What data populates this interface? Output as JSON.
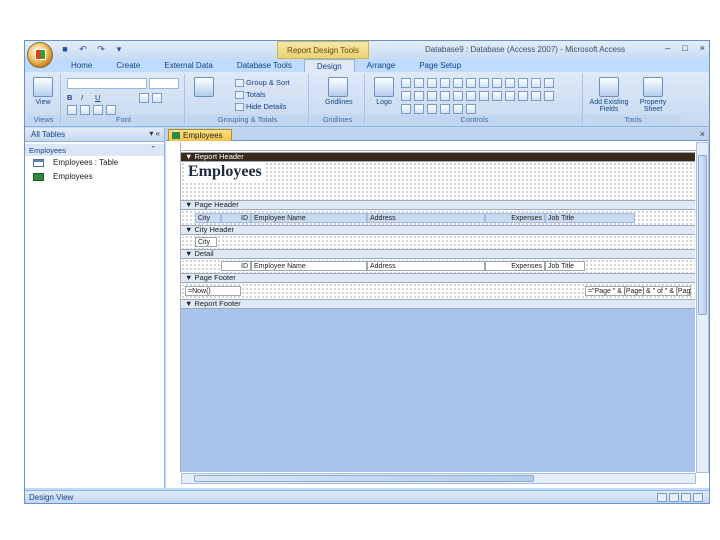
{
  "window": {
    "title": "Database9 : Database (Access 2007) - Microsoft Access",
    "context_tab": "Report Design Tools",
    "controls": [
      "–",
      "□",
      "×"
    ]
  },
  "tabs": [
    {
      "label": "Home"
    },
    {
      "label": "Create"
    },
    {
      "label": "External Data"
    },
    {
      "label": "Database Tools"
    },
    {
      "label": "Design"
    },
    {
      "label": "Arrange"
    },
    {
      "label": "Page Setup"
    }
  ],
  "ribbon": {
    "views": {
      "view_label": "View",
      "group_label": "Views"
    },
    "font": {
      "group_label": "Font",
      "bold": "B",
      "italic": "I",
      "underline": "U"
    },
    "grouping": {
      "group_sort": "Group & Sort",
      "totals": "Totals",
      "hide_details": "Hide Details",
      "group_label": "Grouping & Totals"
    },
    "gridlines": {
      "label": "Gridlines",
      "group_label": "Gridlines"
    },
    "controls": {
      "logo": "Logo",
      "group_label": "Controls"
    },
    "tools": {
      "add_fields": "Add Existing Fields",
      "property_sheet": "Property Sheet",
      "group_label": "Tools"
    }
  },
  "nav": {
    "header": "All Tables",
    "group": "Employees",
    "items": [
      {
        "label": "Employees : Table",
        "icon": "table-icon"
      },
      {
        "label": "Employees",
        "icon": "report-icon"
      }
    ]
  },
  "document": {
    "tab_label": "Employees",
    "sections": {
      "report_header": "Report Header",
      "page_header": "Page Header",
      "city_header": "City Header",
      "detail": "Detail",
      "page_footer": "Page Footer",
      "report_footer": "Report Footer"
    },
    "report_title": "Employees",
    "page_header_labels": [
      "City",
      "ID",
      "Employee Name",
      "Address",
      "Expenses",
      "Job Title"
    ],
    "city_field": "City",
    "detail_fields": [
      "ID",
      "Employee Name",
      "Address",
      "Expenses",
      "Job Title"
    ],
    "footer_left": "=Now()",
    "footer_right": "=\"Page \" & [Page] & \" of \" & [Pages]"
  },
  "status": {
    "text": "Design View"
  },
  "colors": {
    "accent": "#bfdbff",
    "ribbon": "#dfe9f7",
    "section_bar": "#dfe8f5",
    "label_fill": "#c9d9f0"
  }
}
